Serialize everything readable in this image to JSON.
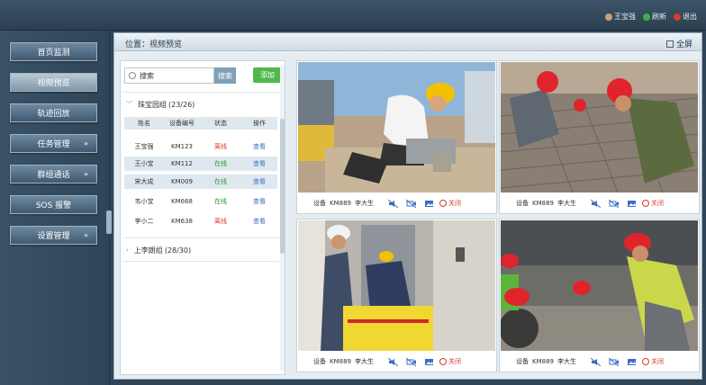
{
  "topbar": {
    "user": "王宝强",
    "refresh": "刷新",
    "logout": "退出"
  },
  "nav": {
    "items": [
      {
        "label": "首页监测",
        "active": false,
        "has_arrow": false
      },
      {
        "label": "视频预览",
        "active": true,
        "has_arrow": false
      },
      {
        "label": "轨迹回放",
        "active": false,
        "has_arrow": false
      },
      {
        "label": "任务管理",
        "active": false,
        "has_arrow": true
      },
      {
        "label": "群组通话",
        "active": false,
        "has_arrow": true
      },
      {
        "label": "SOS 报警",
        "active": false,
        "has_arrow": false
      },
      {
        "label": "设置管理",
        "active": false,
        "has_arrow": true
      }
    ]
  },
  "breadcrumb": {
    "text": "位置：视频预览",
    "fullscreen": "全屏"
  },
  "devices": {
    "search_placeholder": "搜索",
    "search_button": "搜索",
    "add_button": "添加",
    "group1": {
      "label": "珠宝园组",
      "count": "(23/26)"
    },
    "group2": {
      "label": "上李朗组",
      "count": "(28/30)"
    },
    "columns": [
      "姓名",
      "设备编号",
      "状态",
      "操作"
    ],
    "rows": [
      {
        "name": "王宝强",
        "id": "KM123",
        "status": "离线",
        "online": false,
        "op": "查看"
      },
      {
        "name": "王小宝",
        "id": "KM112",
        "status": "在线",
        "online": true,
        "op": "查看"
      },
      {
        "name": "宋大成",
        "id": "KM009",
        "status": "在线",
        "online": true,
        "op": "查看"
      },
      {
        "name": "韦小宝",
        "id": "KM668",
        "status": "在线",
        "online": true,
        "op": "查看"
      },
      {
        "name": "李小二",
        "id": "KM638",
        "status": "离线",
        "online": false,
        "op": "查看"
      }
    ]
  },
  "videos": [
    {
      "label": "设备",
      "device": "KM889",
      "person": "李大生",
      "close": "关闭"
    },
    {
      "label": "设备",
      "device": "KM889",
      "person": "李大生",
      "close": "关闭"
    },
    {
      "label": "设备",
      "device": "KM889",
      "person": "李大生",
      "close": "关闭"
    },
    {
      "label": "设备",
      "device": "KM889",
      "person": "李大生",
      "close": "关闭"
    }
  ],
  "colors": {
    "accent": "#4fb84a",
    "offline": "#e23a2e",
    "online": "#2a9a35",
    "link": "#3a6fc4"
  }
}
